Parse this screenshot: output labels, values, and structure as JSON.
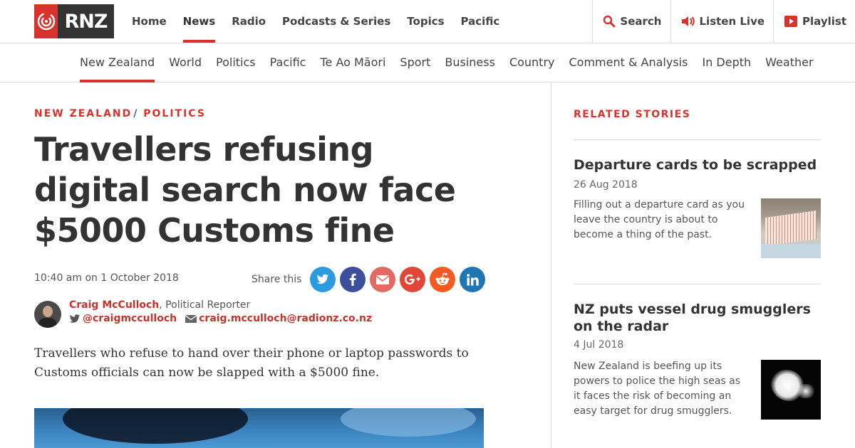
{
  "brand": {
    "logo_text": "RNZ",
    "accent": "#d9312b"
  },
  "main_nav": {
    "items": [
      {
        "label": "Home"
      },
      {
        "label": "News"
      },
      {
        "label": "Radio"
      },
      {
        "label": "Podcasts & Series"
      },
      {
        "label": "Topics"
      },
      {
        "label": "Pacific"
      }
    ],
    "active": "News"
  },
  "tools": {
    "search_label": "Search",
    "listen_label": "Listen Live",
    "playlist_label": "Playlist"
  },
  "sub_nav": {
    "items": [
      {
        "label": "New Zealand"
      },
      {
        "label": "World"
      },
      {
        "label": "Politics"
      },
      {
        "label": "Pacific"
      },
      {
        "label": "Te Ao Māori"
      },
      {
        "label": "Sport"
      },
      {
        "label": "Business"
      },
      {
        "label": "Country"
      },
      {
        "label": "Comment & Analysis"
      },
      {
        "label": "In Depth"
      },
      {
        "label": "Weather"
      }
    ],
    "active": "New Zealand"
  },
  "article": {
    "kicker_1": "NEW ZEALAND",
    "kicker_sep": "/",
    "kicker_2": "POLITICS",
    "headline": "Travellers refusing digital search now face $5000 Customs fine",
    "dateline": "10:40 am on 1 October 2018",
    "share_label": "Share this",
    "share_buttons": [
      {
        "icon": "twitter-icon",
        "color": "#2a9bdc"
      },
      {
        "icon": "facebook-icon",
        "color": "#3b4f9b"
      },
      {
        "icon": "email-icon",
        "color": "#e36a63"
      },
      {
        "icon": "google-plus-icon",
        "color": "#e0463a"
      },
      {
        "icon": "reddit-icon",
        "color": "#f25c22"
      },
      {
        "icon": "linkedin-icon",
        "color": "#1e76b4"
      }
    ],
    "author_name": "Craig McCulloch",
    "author_role": ", Political Reporter",
    "author_twitter": "@craigmcculloch",
    "author_email": "craig.mcculloch@radionz.co.nz",
    "lede": "Travellers who refuse to hand over their phone or laptop passwords to Customs officials can now be slapped with a $5000 fine."
  },
  "related": {
    "title": "RELATED STORIES",
    "stories": [
      {
        "headline": "Departure cards to be scrapped",
        "date": "26 Aug 2018",
        "summary": "Filling out a departure card as you leave the country is about to become a thing of the past."
      },
      {
        "headline": "NZ puts vessel drug smugglers on the radar",
        "date": "4 Jul 2018",
        "summary": "New Zealand is beefing up its powers to police the high seas as it faces the risk of becoming an easy target for drug smugglers."
      }
    ]
  }
}
